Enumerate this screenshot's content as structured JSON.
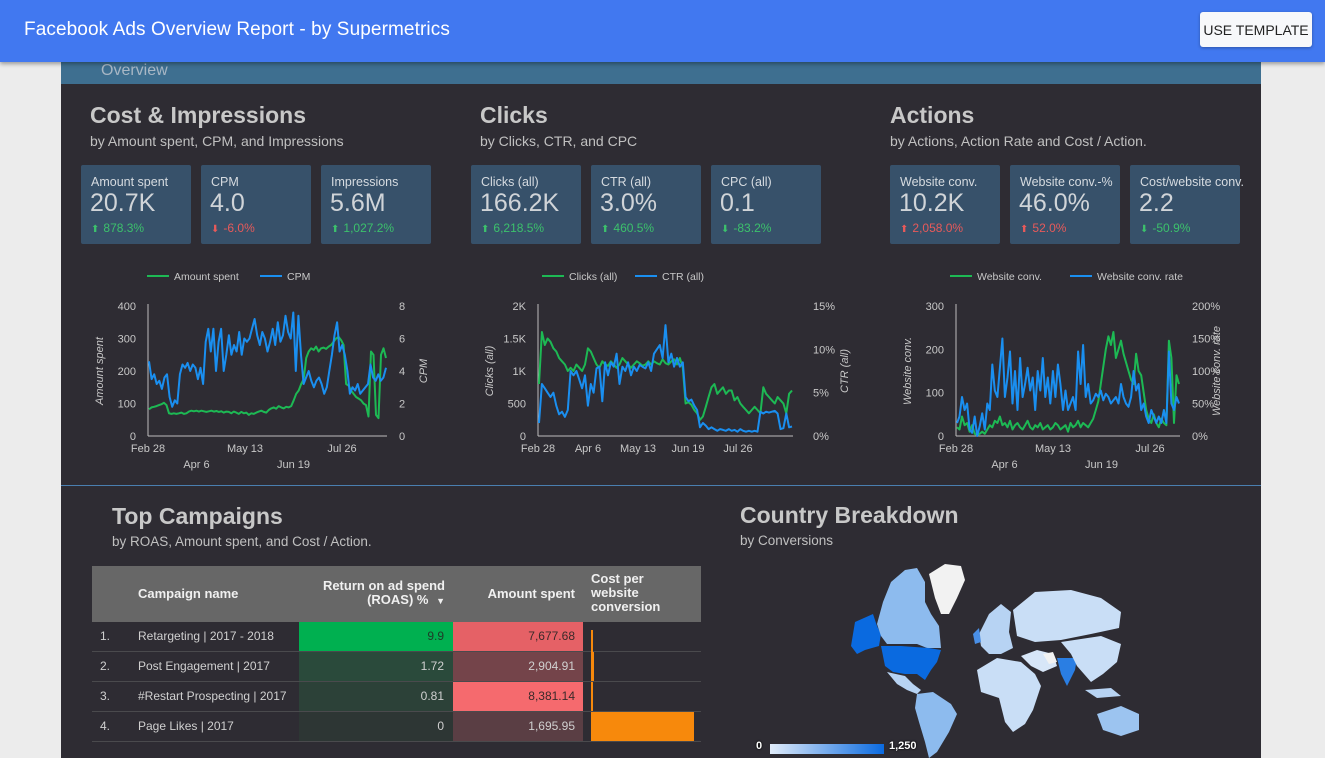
{
  "header": {
    "title": "Facebook Ads Overview Report - by Supermetrics",
    "use_template_label": "USE TEMPLATE",
    "brand_color": "#4178f0"
  },
  "overview_label": "Overview",
  "sections": {
    "cost": {
      "title": "Cost & Impressions",
      "subtitle": "by Amount spent, CPM, and Impressions",
      "kpis": [
        {
          "label": "Amount spent",
          "value": "20.7K",
          "delta": "878.3%",
          "direction": "up",
          "sentiment": "good"
        },
        {
          "label": "CPM",
          "value": "4.0",
          "delta": "-6.0%",
          "direction": "down",
          "sentiment": "bad"
        },
        {
          "label": "Impressions",
          "value": "5.6M",
          "delta": "1,027.2%",
          "direction": "up",
          "sentiment": "good"
        }
      ]
    },
    "clicks": {
      "title": "Clicks",
      "subtitle": "by Clicks, CTR, and CPC",
      "kpis": [
        {
          "label": "Clicks (all)",
          "value": "166.2K",
          "delta": "6,218.5%",
          "direction": "up",
          "sentiment": "good"
        },
        {
          "label": "CTR (all)",
          "value": "3.0%",
          "delta": "460.5%",
          "direction": "up",
          "sentiment": "good"
        },
        {
          "label": "CPC (all)",
          "value": "0.1",
          "delta": "-83.2%",
          "direction": "down",
          "sentiment": "good"
        }
      ]
    },
    "actions": {
      "title": "Actions",
      "subtitle": "by Actions, Action Rate and Cost / Action.",
      "kpis": [
        {
          "label": "Website conv.",
          "value": "10.2K",
          "delta": "2,058.0%",
          "direction": "up",
          "sentiment": "bad"
        },
        {
          "label": "Website conv.-%",
          "value": "46.0%",
          "delta": "52.0%",
          "direction": "up",
          "sentiment": "bad"
        },
        {
          "label": "Cost/website conv.",
          "value": "2.2",
          "delta": "-50.9%",
          "direction": "down",
          "sentiment": "good"
        }
      ]
    },
    "campaigns": {
      "title": "Top Campaigns",
      "subtitle": "by ROAS, Amount spent, and Cost / Action.",
      "columns": [
        "Campaign name",
        "Return on ad spend (ROAS) %",
        "Amount spent",
        "Cost per website conversion"
      ],
      "sort_indicator": "▼",
      "rows": [
        {
          "index": "1.",
          "name": "Retargeting | 2017 - 2018",
          "roas": "9.9",
          "amount": "7,677.68",
          "cost_per_conv": 0.01
        },
        {
          "index": "2.",
          "name": "Post Engagement | 2017",
          "roas": "1.72",
          "amount": "2,904.91",
          "cost_per_conv": 0.03
        },
        {
          "index": "3.",
          "name": "#Restart Prospecting | 2017",
          "roas": "0.81",
          "amount": "8,381.14",
          "cost_per_conv": 0.02
        },
        {
          "index": "4.",
          "name": "Page Likes | 2017",
          "roas": "0",
          "amount": "1,695.95",
          "cost_per_conv": 1.0
        }
      ]
    },
    "country": {
      "title": "Country Breakdown",
      "subtitle": "by Conversions",
      "legend_min": "0",
      "legend_max": "1,250",
      "scale_colors": [
        "#e1ecfa",
        "#0a6ae0"
      ],
      "highlighted_regions": [
        {
          "name": "United States",
          "level": "high"
        },
        {
          "name": "India",
          "level": "high"
        },
        {
          "name": "Canada",
          "level": "mid"
        },
        {
          "name": "United Kingdom",
          "level": "mid"
        },
        {
          "name": "Brazil",
          "level": "mid"
        },
        {
          "name": "Australia",
          "level": "mid"
        },
        {
          "name": "Greenland",
          "level": "none"
        }
      ]
    }
  },
  "chart_data": [
    {
      "type": "line",
      "title": "Amount spent / CPM",
      "x_ticks": [
        "Feb 28",
        "Apr 6",
        "May 13",
        "Jun 19",
        "Jul 26"
      ],
      "x_tick_rows": [
        0,
        1,
        0,
        1,
        0
      ],
      "ylabel": "Amount spent",
      "y2label": "CPM",
      "ylim": [
        0,
        400
      ],
      "y2lim": [
        0,
        8
      ],
      "y_ticks": [
        "0",
        "100",
        "200",
        "300",
        "400"
      ],
      "y2_ticks": [
        "0",
        "2",
        "4",
        "6",
        "8"
      ],
      "legend_position": "top",
      "series": [
        {
          "name": "Amount spent",
          "axis": "left",
          "color": "#1db954",
          "values": [
            82,
            88,
            90,
            92,
            95,
            98,
            102,
            95,
            70,
            68,
            70,
            68,
            70,
            72,
            68,
            70,
            75,
            78,
            76,
            78,
            75,
            78,
            76,
            74,
            76,
            78,
            75,
            77,
            74,
            76,
            72,
            75,
            74,
            70,
            75,
            72,
            68,
            74,
            70,
            72,
            65,
            70,
            68,
            72,
            75,
            78,
            74,
            72,
            80,
            85,
            88,
            84,
            92,
            88,
            85,
            90,
            88,
            92,
            110,
            130,
            140,
            160,
            175,
            240,
            260,
            270,
            265,
            275,
            260,
            270,
            272,
            268,
            275,
            280,
            290,
            300,
            305,
            295,
            280,
            160,
            155,
            140,
            130,
            120,
            115,
            110,
            100,
            95,
            60,
            260,
            250,
            65,
            55,
            250,
            270,
            240
          ]
        },
        {
          "name": "CPM",
          "axis": "right",
          "color": "#1a8ff0",
          "values": [
            4.6,
            3.5,
            3.8,
            3.2,
            3.4,
            2.9,
            3.6,
            3.8,
            2.4,
            1.8,
            2.2,
            2.0,
            3.8,
            4.4,
            4.2,
            4.5,
            4.0,
            4.4,
            4.2,
            3.5,
            4.2,
            3.2,
            5.8,
            6.6,
            5.2,
            6.6,
            4.0,
            5.8,
            6.6,
            4.0,
            5.0,
            6.2,
            5.0,
            5.6,
            5.2,
            6.4,
            5.0,
            6.0,
            5.8,
            6.0,
            6.6,
            7.2,
            6.2,
            5.6,
            6.4,
            6.0,
            5.2,
            5.8,
            6.6,
            5.6,
            7.0,
            5.8,
            6.2,
            7.4,
            6.4,
            6.0,
            7.6,
            4.0,
            7.4,
            5.0,
            3.2,
            3.6,
            4.0,
            3.4,
            3.0,
            3.4,
            3.6,
            3.2,
            2.6,
            3.0,
            4.0,
            5.0,
            6.2,
            7.0,
            5.2,
            5.6,
            5.0,
            4.0,
            2.6,
            3.0,
            2.8,
            3.2,
            2.6,
            2.8,
            3.0,
            3.2,
            4.4,
            3.6,
            3.4,
            3.8,
            3.4,
            3.6,
            4.2
          ]
        }
      ]
    },
    {
      "type": "line",
      "title": "Clicks (all) / CTR (all)",
      "x_ticks": [
        "Feb 28",
        "Apr 6",
        "May 13",
        "Jun 19",
        "Jul 26"
      ],
      "x_tick_rows": [
        0,
        0,
        0,
        0,
        0
      ],
      "ylabel": "Clicks (all)",
      "y2label": "CTR (all)",
      "ylim": [
        0,
        2000
      ],
      "y2lim": [
        0,
        15
      ],
      "y_ticks": [
        "0",
        "500",
        "1K",
        "1.5K",
        "2K"
      ],
      "y2_ticks": [
        "0%",
        "5%",
        "10%",
        "15%"
      ],
      "legend_position": "top",
      "series": [
        {
          "name": "Clicks (all)",
          "axis": "left",
          "color": "#1db954",
          "values": [
            800,
            1600,
            1400,
            1500,
            1450,
            1350,
            1300,
            1200,
            1150,
            1100,
            1000,
            1050,
            1000,
            1100,
            1050,
            1000,
            1100,
            1350,
            1300,
            1200,
            1100,
            1050,
            1150,
            1100,
            1080,
            1150,
            1100,
            1050,
            1100,
            1200,
            1150,
            1100,
            1050,
            1100,
            1150,
            1120,
            1080,
            1100,
            1150,
            1100,
            1150,
            1120,
            1100,
            1180,
            1120,
            1100,
            1150,
            1180,
            1100,
            1200,
            1050,
            500,
            520,
            480,
            400,
            350,
            250,
            300,
            450,
            600,
            750,
            800,
            650,
            700,
            750,
            650,
            700,
            700,
            550,
            600,
            500,
            450,
            400,
            350,
            400,
            450,
            400,
            350,
            750,
            650,
            600,
            550,
            500,
            600,
            550,
            500,
            350,
            650,
            700
          ]
        },
        {
          "name": "CTR (all)",
          "axis": "right",
          "color": "#1a8ff0",
          "values": [
            1.5,
            6.0,
            5.5,
            5.0,
            4.5,
            5.0,
            3.5,
            2.5,
            2.8,
            2.2,
            3.0,
            7.5,
            7.0,
            7.5,
            6.5,
            5.5,
            7.0,
            3.5,
            6.0,
            5.0,
            7.8,
            8.0,
            4.0,
            8.5,
            7.0,
            8.5,
            8.0,
            9.5,
            6.0,
            8.0,
            7.5,
            8.5,
            7.0,
            8.0,
            7.5,
            8.2,
            8.0,
            7.8,
            8.5,
            7.5,
            9.5,
            10.0,
            10.5,
            9.0,
            12.8,
            8.5,
            9.5,
            8.0,
            9.0,
            8.0,
            8.5,
            4.5,
            4.0,
            4.2,
            3.5,
            3.0,
            1.0,
            1.5,
            1.2,
            0.8,
            1.0,
            0.8,
            0.6,
            0.8,
            0.7,
            0.6,
            0.8,
            0.6,
            0.7,
            0.5,
            0.8,
            0.6,
            0.5,
            0.6,
            0.5,
            0.6,
            0.5,
            2.8,
            2.6,
            2.8,
            2.7,
            2.8,
            2.9,
            2.6,
            0.8,
            0.9,
            2.6,
            1.0,
            1.1
          ]
        }
      ]
    },
    {
      "type": "line",
      "title": "Website conv. / Website conv. rate",
      "x_ticks": [
        "Feb 28",
        "Apr 6",
        "May 13",
        "Jun 19",
        "Jul 26"
      ],
      "x_tick_rows": [
        0,
        1,
        0,
        1,
        0
      ],
      "ylabel": "Website conv.",
      "y2label": "Website conv. rate",
      "ylim": [
        0,
        300
      ],
      "y2lim": [
        0,
        200
      ],
      "y_ticks": [
        "0",
        "100",
        "200",
        "300"
      ],
      "y2_ticks": [
        "0%",
        "50%",
        "100%",
        "150%",
        "200%"
      ],
      "legend_position": "top",
      "series": [
        {
          "name": "Website conv.",
          "axis": "left",
          "color": "#1db954",
          "values": [
            20,
            15,
            45,
            25,
            30,
            10,
            25,
            5,
            2,
            5,
            10,
            5,
            15,
            25,
            20,
            35,
            30,
            45,
            25,
            30,
            20,
            35,
            15,
            25,
            30,
            20,
            15,
            25,
            35,
            20,
            15,
            25,
            20,
            30,
            15,
            20,
            25,
            15,
            20,
            30,
            25,
            15,
            20,
            25,
            10,
            30,
            20,
            25,
            35,
            20,
            30,
            25,
            20,
            30,
            40,
            60,
            80,
            120,
            160,
            200,
            230,
            210,
            240,
            180,
            200,
            220,
            190,
            170,
            150,
            130,
            120,
            190,
            150,
            140,
            100,
            60,
            40,
            30,
            50,
            30,
            20,
            40,
            30,
            25,
            220,
            180,
            30,
            140,
            120
          ]
        },
        {
          "name": "Website conv. rate",
          "axis": "right",
          "color": "#1a8ff0",
          "values": [
            20,
            30,
            60,
            40,
            50,
            10,
            5,
            30,
            0,
            15,
            35,
            10,
            50,
            40,
            110,
            70,
            60,
            105,
            150,
            60,
            90,
            130,
            50,
            100,
            40,
            120,
            60,
            80,
            105,
            70,
            90,
            40,
            100,
            70,
            120,
            60,
            90,
            50,
            100,
            60,
            110,
            80,
            40,
            70,
            40,
            50,
            60,
            40,
            130,
            80,
            140,
            60,
            80,
            50,
            55,
            65,
            60,
            70,
            55,
            65,
            60,
            50,
            55,
            60,
            50,
            80,
            60,
            50,
            45,
            60,
            100,
            70,
            80,
            40,
            50,
            30,
            20,
            40,
            30,
            20,
            30,
            20,
            40,
            20,
            130,
            50,
            40,
            60,
            50
          ]
        }
      ]
    }
  ]
}
